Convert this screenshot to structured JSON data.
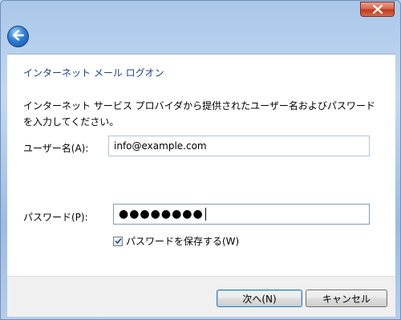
{
  "window": {
    "close_icon": "close-icon",
    "back_icon": "back-arrow-icon"
  },
  "page": {
    "heading": "インターネット メール ログオン",
    "instruction": "インターネット サービス プロバイダから提供されたユーザー名およびパスワードを入力してください。"
  },
  "form": {
    "username_label": "ユーザー名(A):",
    "username_value": "info@example.com",
    "password_label": "パスワード(P):",
    "password_masked": "●●●●●●●●",
    "remember_checked": true,
    "remember_label": "パスワードを保存する(W)"
  },
  "footer": {
    "next_label": "次へ(N)",
    "cancel_label": "キャンセル"
  },
  "colors": {
    "heading": "#1d3f88",
    "close_button": "#c0391f",
    "back_button": "#2f7fd6"
  }
}
